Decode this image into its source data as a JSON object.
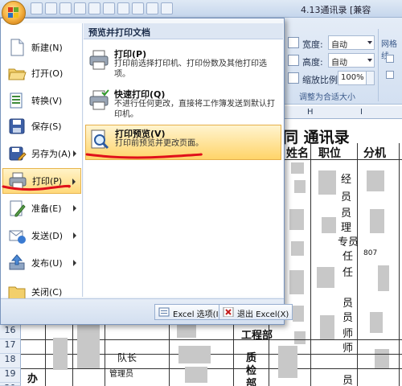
{
  "window": {
    "title": "4.13通讯录 [兼容"
  },
  "ribbon": {
    "width_label": "宽度:",
    "width_value": "自动",
    "height_label": "高度:",
    "height_value": "自动",
    "scale_label": "缩放比例:",
    "scale_value": "100%",
    "group_label": "调整为合适大小",
    "right_group_label": "网格线"
  },
  "menu": {
    "left_items": [
      {
        "label": "新建(N)",
        "icon": "new-document-icon",
        "submenu": false
      },
      {
        "label": "打开(O)",
        "icon": "open-folder-icon",
        "submenu": false
      },
      {
        "label": "转换(V)",
        "icon": "convert-icon",
        "submenu": false
      },
      {
        "label": "保存(S)",
        "icon": "save-icon",
        "submenu": false
      },
      {
        "label": "另存为(A)",
        "icon": "save-as-icon",
        "submenu": true
      },
      {
        "label": "打印(P)",
        "icon": "printer-icon",
        "submenu": true,
        "active": true
      },
      {
        "label": "准备(E)",
        "icon": "prepare-icon",
        "submenu": true
      },
      {
        "label": "发送(D)",
        "icon": "send-icon",
        "submenu": true
      },
      {
        "label": "发布(U)",
        "icon": "publish-icon",
        "submenu": true
      },
      {
        "label": "关闭(C)",
        "icon": "close-folder-icon",
        "submenu": false
      }
    ],
    "right_header": "预览并打印文档",
    "right_items": [
      {
        "title": "打印(P)",
        "desc": "打印前选择打印机、打印份数及其他打印选项。",
        "icon": "printer-icon"
      },
      {
        "title": "快速打印(Q)",
        "desc": "不进行任何更改，直接将工作簿发送到默认打印机。",
        "icon": "quick-print-icon"
      },
      {
        "title": "打印预览(V)",
        "desc": "打印前预览并更改页面。",
        "icon": "print-preview-icon",
        "active": true
      }
    ],
    "options_button": "Excel 选项(I)",
    "exit_button": "退出 Excel(X)"
  },
  "sheet": {
    "title": "同 通讯录",
    "columns": [
      "姓名",
      "职位",
      "分机"
    ],
    "row_numbers": [
      "16",
      "17",
      "18",
      "19",
      "20"
    ],
    "visible_cells": [
      "经",
      "员",
      "员",
      "理",
      "专员",
      "任",
      "任",
      "员",
      "员",
      "师",
      "师",
      "员",
      "工程部",
      "质",
      "检",
      "部",
      "队长",
      "管理员",
      "办",
      "807"
    ]
  },
  "colors": {
    "accent": "#ffd97a",
    "annotation": "#e0101a"
  }
}
